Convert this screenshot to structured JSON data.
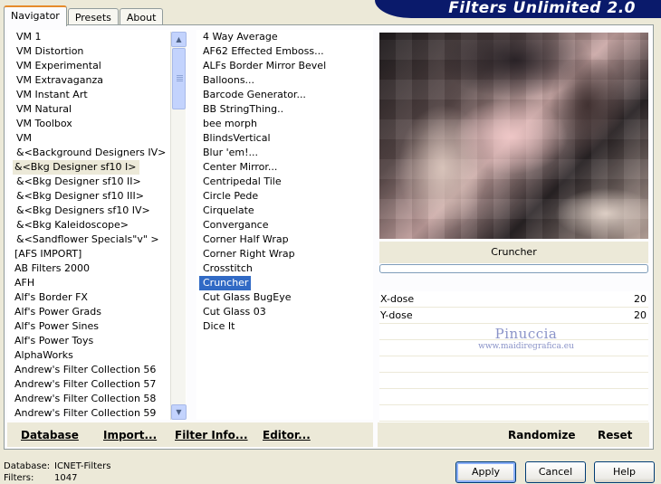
{
  "tabs": [
    "Navigator",
    "Presets",
    "About"
  ],
  "logo": "Filters Unlimited 2.0",
  "categories": [
    "VM 1",
    "VM Distortion",
    "VM Experimental",
    "VM Extravaganza",
    "VM Instant Art",
    "VM Natural",
    "VM Toolbox",
    "VM",
    "&<Background Designers IV>",
    "&<Bkg Designer sf10 I>",
    "&<Bkg Designer sf10 II>",
    "&<Bkg Designer sf10 III>",
    "&<Bkg Designers sf10 IV>",
    "&<Bkg Kaleidoscope>",
    "&<Sandflower Specials\"v\" >",
    "[AFS IMPORT]",
    "AB Filters 2000",
    "AFH",
    "Alf's Border FX",
    "Alf's Power Grads",
    "Alf's Power Sines",
    "Alf's Power Toys",
    "AlphaWorks",
    "Andrew's Filter Collection 56",
    "Andrew's Filter Collection 57",
    "Andrew's Filter Collection 58",
    "Andrew's Filter Collection 59"
  ],
  "selected_category": "&<Bkg Designer sf10 I>",
  "filters": [
    "4 Way Average",
    "AF62 Effected Emboss...",
    "ALFs Border Mirror Bevel",
    "Balloons...",
    "Barcode Generator...",
    "BB StringThing..",
    "bee morph",
    "BlindsVertical",
    "Blur 'em!...",
    "Center Mirror...",
    "Centripedal Tile",
    "Circle Pede",
    "Cirquelate",
    "Convergance",
    "Corner Half Wrap",
    "Corner Right Wrap",
    "Crosstitch",
    "Cruncher",
    "Cut Glass  BugEye",
    "Cut Glass 03",
    "Dice It"
  ],
  "selected_filter": "Cruncher",
  "preview": {
    "filter_name": "Cruncher",
    "progress": 0
  },
  "params": [
    {
      "label": "X-dose",
      "value": "20"
    },
    {
      "label": "Y-dose",
      "value": "20"
    }
  ],
  "watermark": {
    "line1": "Pinuccia",
    "line2": "www.maidiregrafica.eu"
  },
  "bottom_links": {
    "database": "Database",
    "import": "Import...",
    "filter_info": "Filter Info...",
    "editor": "Editor..."
  },
  "right_links": {
    "randomize": "Randomize",
    "reset": "Reset"
  },
  "status": {
    "database_label": "Database:",
    "database_value": "ICNET-Filters",
    "filters_label": "Filters:",
    "filters_value": "1047"
  },
  "buttons": {
    "apply": "Apply",
    "cancel": "Cancel",
    "help": "Help"
  },
  "colors": {
    "accent": "#316ac5",
    "logo_bg": "#0a1a6b",
    "dialog_bg": "#ece9d8"
  }
}
